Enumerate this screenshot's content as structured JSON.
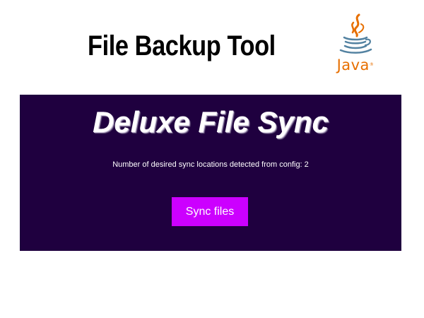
{
  "header": {
    "title": "File Backup Tool",
    "logo": {
      "icon": "java-coffee-cup-icon",
      "wordmark": "Java",
      "trademark": "®",
      "colors": {
        "cup": "#5382a1",
        "steam": "#e76f00",
        "wordmark": "#e76f00"
      }
    }
  },
  "app": {
    "background_color": "#1f003f",
    "title": "Deluxe File Sync",
    "status_text": "Number of desired sync locations detected from config: 2",
    "sync_button": {
      "label": "Sync files",
      "color": "#cc00ff"
    }
  }
}
